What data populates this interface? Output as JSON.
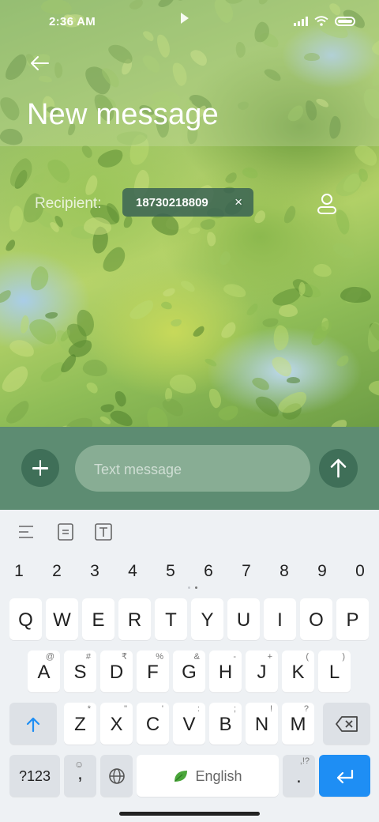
{
  "status_bar": {
    "time": "2:36 AM"
  },
  "header": {
    "title": "New message"
  },
  "recipient": {
    "label": "Recipient:",
    "chip": "18730218809",
    "chip_remove": "×"
  },
  "compose": {
    "placeholder": "Text message"
  },
  "keyboard": {
    "numbers": [
      "1",
      "2",
      "3",
      "4",
      "5",
      "6",
      "7",
      "8",
      "9",
      "0"
    ],
    "row1": [
      {
        "key": "Q",
        "hint": ""
      },
      {
        "key": "W",
        "hint": ""
      },
      {
        "key": "E",
        "hint": ""
      },
      {
        "key": "R",
        "hint": ""
      },
      {
        "key": "T",
        "hint": ""
      },
      {
        "key": "Y",
        "hint": ""
      },
      {
        "key": "U",
        "hint": ""
      },
      {
        "key": "I",
        "hint": ""
      },
      {
        "key": "O",
        "hint": ""
      },
      {
        "key": "P",
        "hint": ""
      }
    ],
    "row2": [
      {
        "key": "A",
        "hint": "@"
      },
      {
        "key": "S",
        "hint": "#"
      },
      {
        "key": "D",
        "hint": "₹"
      },
      {
        "key": "F",
        "hint": "%"
      },
      {
        "key": "G",
        "hint": "&"
      },
      {
        "key": "H",
        "hint": "-"
      },
      {
        "key": "J",
        "hint": "+"
      },
      {
        "key": "K",
        "hint": "("
      },
      {
        "key": "L",
        "hint": ")"
      }
    ],
    "row3": [
      {
        "key": "Z",
        "hint": "*"
      },
      {
        "key": "X",
        "hint": "\""
      },
      {
        "key": "C",
        "hint": "'"
      },
      {
        "key": "V",
        "hint": ":"
      },
      {
        "key": "B",
        "hint": ";"
      },
      {
        "key": "N",
        "hint": "!"
      },
      {
        "key": "M",
        "hint": "?"
      }
    ],
    "symbols_label": "?123",
    "comma_label": ",",
    "space_label": "English",
    "period_label": ".",
    "period_hint": ",!?"
  },
  "colors": {
    "accent": "#1e8ef4",
    "compose_bar": "#5d8c72",
    "button": "#3f6f58"
  }
}
